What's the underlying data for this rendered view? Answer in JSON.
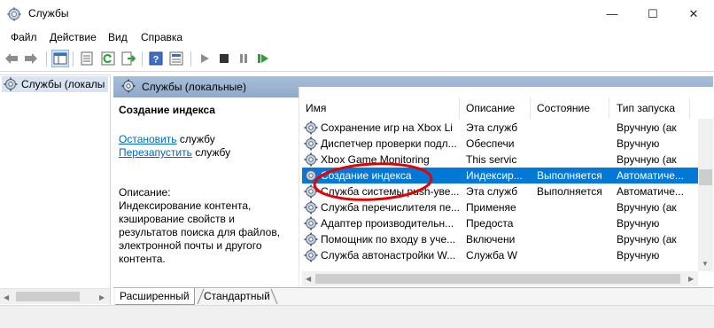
{
  "window": {
    "title": "Службы",
    "minimize": "—",
    "maximize": "☐",
    "close": "✕"
  },
  "menu": [
    "Файл",
    "Действие",
    "Вид",
    "Справка"
  ],
  "tree": {
    "root_label": "Службы (локалы"
  },
  "panel": {
    "header": "Службы (локальные)"
  },
  "detail": {
    "service_name": "Создание индекса",
    "stop_link": "Остановить",
    "stop_suffix": " службу",
    "restart_link": "Перезапустить",
    "restart_suffix": " службу",
    "description_label": "Описание:",
    "description_lines": [
      "Индексирование контента,",
      "кэширование свойств и",
      "результатов поиска для файлов,",
      "электронной почты и другого",
      "контента."
    ]
  },
  "table": {
    "columns": [
      "Имя",
      "Описание",
      "Состояние",
      "Тип запуска"
    ],
    "rows": [
      {
        "name": "Сохранение игр на Xbox Li",
        "desc": "Эта служб",
        "state": "",
        "startup": "Вручную (ак",
        "selected": false
      },
      {
        "name": "Диспетчер проверки подл...",
        "desc": "Обеспечи",
        "state": "",
        "startup": "Вручную",
        "selected": false
      },
      {
        "name": "Xbox Game Monitoring",
        "desc": "This servic",
        "state": "",
        "startup": "Вручную (ак",
        "selected": false
      },
      {
        "name": "Создание индекса",
        "desc": "Индексир...",
        "state": "Выполняется",
        "startup": "Автоматиче...",
        "selected": true
      },
      {
        "name": "Служба системы push-уве...",
        "desc": "Эта служб",
        "state": "Выполняется",
        "startup": "Автоматиче...",
        "selected": false
      },
      {
        "name": "Служба перечислителя пе...",
        "desc": "Применяе",
        "state": "",
        "startup": "Вручную (ак",
        "selected": false
      },
      {
        "name": "Адаптер производительн...",
        "desc": "Предоста",
        "state": "",
        "startup": "Вручную",
        "selected": false
      },
      {
        "name": "Помощник по входу в уче...",
        "desc": "Включени",
        "state": "",
        "startup": "Вручную (ак",
        "selected": false
      },
      {
        "name": "Служба автонастройки W...",
        "desc": "Служба W",
        "state": "",
        "startup": "Вручную",
        "selected": false
      }
    ]
  },
  "tabs": [
    "Расширенный",
    "Стандартный"
  ],
  "colors": {
    "selection": "#0078d7",
    "link": "#0066cc",
    "annotation": "#e00000"
  }
}
